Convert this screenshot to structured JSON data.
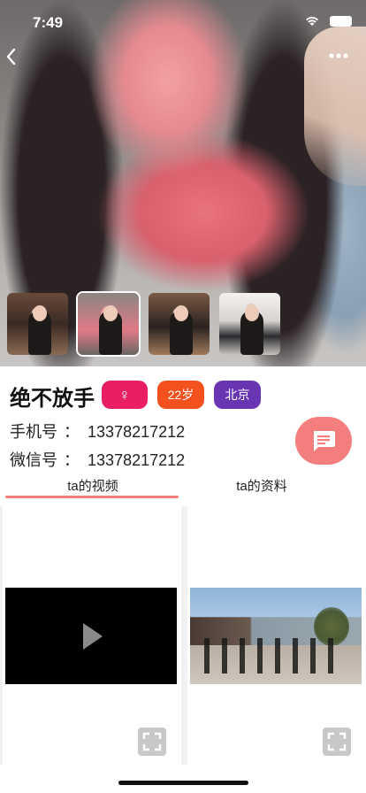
{
  "status_bar": {
    "time": "7:49",
    "icons": [
      "wifi-icon",
      "battery-icon"
    ]
  },
  "nav": {
    "back_icon": "chevron-left-icon",
    "more_icon": "more-dots-icon"
  },
  "gallery": {
    "thumbnails": [
      {
        "active": false
      },
      {
        "active": true
      },
      {
        "active": false
      },
      {
        "active": false
      }
    ]
  },
  "profile": {
    "name": "绝不放手",
    "gender_symbol": "♀",
    "age": "22岁",
    "city": "北京",
    "phone_label": "手机号",
    "phone_sep": "：",
    "phone_value": "13378217212",
    "wechat_label": "微信号",
    "wechat_sep": "：",
    "wechat_value": "13378217212"
  },
  "tabs": [
    {
      "label": "ta的视频",
      "active": true
    },
    {
      "label": "ta的资料",
      "active": false
    }
  ],
  "videos": [
    {
      "thumb": "black-with-play-icon"
    },
    {
      "thumb": "street-scene"
    }
  ],
  "colors": {
    "accent": "#f47e7e",
    "gender_tag": "#e91e63",
    "age_tag": "#f4511e",
    "city_tag": "#6a35b3"
  }
}
